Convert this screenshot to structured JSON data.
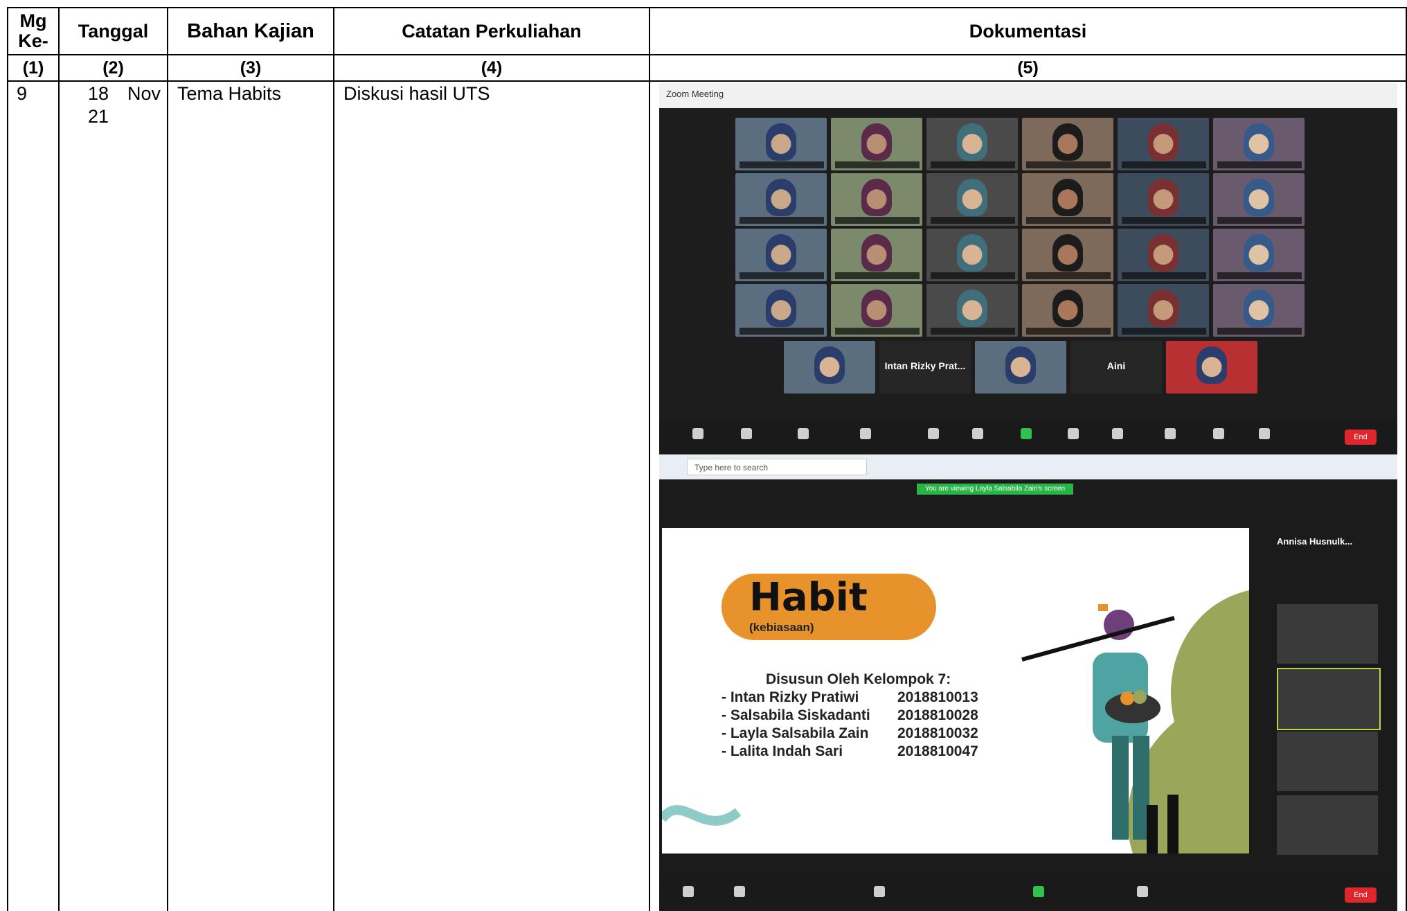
{
  "headers": {
    "mg": "Mg Ke-",
    "tanggal": "Tanggal",
    "bahan": "Bahan Kajian",
    "catatan": "Catatan Perkuliahan",
    "dokumentasi": "Dokumentasi"
  },
  "column_numbers": [
    "(1)",
    "(2)",
    "(3)",
    "(4)",
    "(5)"
  ],
  "row": {
    "mg": "9",
    "tanggal_day": "18",
    "tanggal_month": "Nov",
    "tanggal_year": "21",
    "bahan": "Tema Habits",
    "catatan": "Diskusi hasil UTS"
  },
  "screenshot": {
    "window_title": "Zoom Meeting",
    "name_tile_1": "Intan Rizky Prat...",
    "name_tile_2": "Aini",
    "search_placeholder": "Type here to search",
    "end_label": "End",
    "viewing_banner": "You are viewing Layla Salsabila Zain's screen",
    "slide_title": "Habit",
    "slide_subtitle": "(kebiasaan)",
    "slide_group": "Disusun Oleh Kelompok 7:",
    "members": [
      {
        "name": "- Intan Rizky Pratiwi",
        "nim": "2018810013"
      },
      {
        "name": "- Salsabila Siskadanti",
        "nim": "2018810028"
      },
      {
        "name": "- Layla Salsabila Zain",
        "nim": "2018810032"
      },
      {
        "name": "- Lalita Indah Sari",
        "nim": "2018810047"
      }
    ],
    "side_name": "Annisa Husnulk..."
  }
}
